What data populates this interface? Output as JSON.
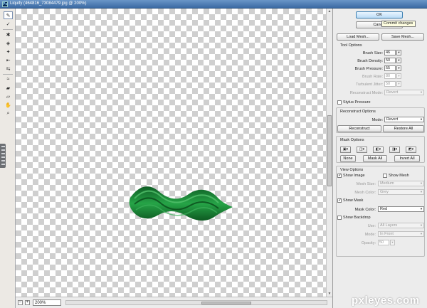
{
  "window": {
    "title": "Liquify (464816_73084479.jpg @ 200%)"
  },
  "tools": [
    {
      "name": "forward-warp-icon",
      "glyph": "✎"
    },
    {
      "name": "reconstruct-icon",
      "glyph": "✓"
    },
    {
      "name": "twirl-icon",
      "glyph": "✱"
    },
    {
      "name": "pucker-icon",
      "glyph": "◈"
    },
    {
      "name": "bloat-icon",
      "glyph": "✦"
    },
    {
      "name": "push-left-icon",
      "glyph": "⇤"
    },
    {
      "name": "mirror-icon",
      "glyph": "⇆"
    },
    {
      "name": "turbulence-icon",
      "glyph": "≈"
    },
    {
      "name": "freeze-mask-icon",
      "glyph": "▰"
    },
    {
      "name": "thaw-mask-icon",
      "glyph": "▱"
    },
    {
      "name": "hand-icon",
      "glyph": "✋"
    },
    {
      "name": "zoom-icon",
      "glyph": "⌕"
    }
  ],
  "canvas": {
    "shape_color": "#1f8a3a"
  },
  "status": {
    "zoom": "200%",
    "zoom_out": "–",
    "zoom_in": "+"
  },
  "panel": {
    "ok": "OK",
    "cancel": "Cancel",
    "tooltip": "Commit changes",
    "load_mesh": "Load Mesh...",
    "save_mesh": "Save Mesh...",
    "tool_options": {
      "title": "Tool Options",
      "brush_size": {
        "label": "Brush Size:",
        "value": "46"
      },
      "brush_density": {
        "label": "Brush Density:",
        "value": "50"
      },
      "brush_pressure": {
        "label": "Brush Pressure:",
        "value": "55"
      },
      "brush_rate": {
        "label": "Brush Rate:",
        "value": "80"
      },
      "turbulent_jitter": {
        "label": "Turbulent Jitter:",
        "value": "50"
      },
      "reconstruct_mode": {
        "label": "Reconstruct Mode:",
        "value": "Revert"
      },
      "stylus_pressure": "Stylus Pressure"
    },
    "reconstruct_options": {
      "title": "Reconstruct Options",
      "mode_label": "Mode:",
      "mode_value": "Revert",
      "reconstruct": "Reconstruct",
      "restore_all": "Restore All"
    },
    "mask_options": {
      "title": "Mask Options",
      "none": "None",
      "mask_all": "Mask All",
      "invert_all": "Invert All"
    },
    "view_options": {
      "title": "View Options",
      "show_image": "Show Image",
      "show_mesh": "Show Mesh",
      "mesh_size_label": "Mesh Size:",
      "mesh_size_value": "Medium",
      "mesh_color_label": "Mesh Color:",
      "mesh_color_value": "Grey",
      "show_mask": "Show Mask",
      "mask_color_label": "Mask Color:",
      "mask_color_value": "Red",
      "show_backdrop": "Show Backdrop",
      "use_label": "Use:",
      "use_value": "All Layers",
      "mode_label": "Mode:",
      "mode_value": "In Front",
      "opacity_label": "Opacity:",
      "opacity_value": "50"
    }
  },
  "watermark": "pxleyes.com"
}
